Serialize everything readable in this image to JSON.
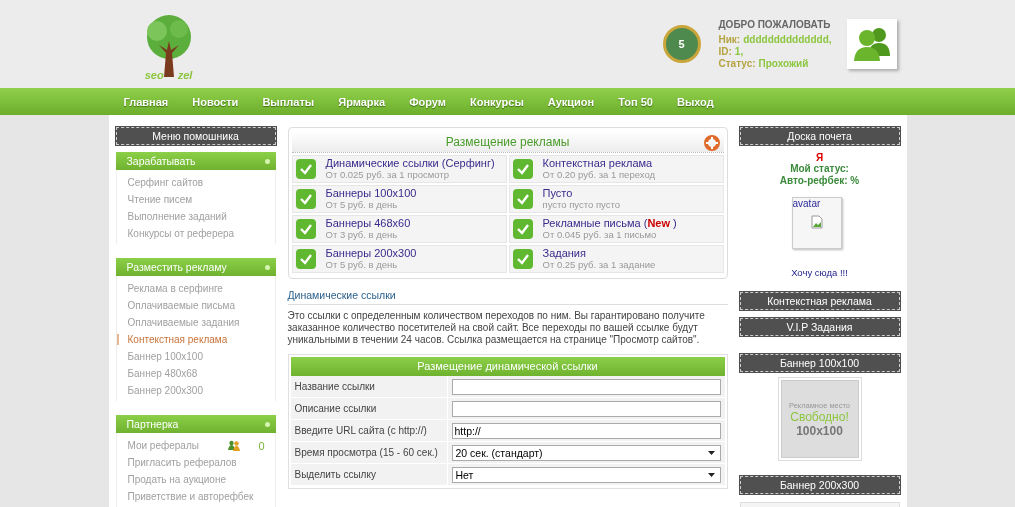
{
  "header": {
    "logo_words": [
      "seo",
      "zel"
    ],
    "rank": "5",
    "welcome": {
      "title": "ДОБРО ПОЖАЛОВАТЬ",
      "lines": [
        {
          "label": "Ник:",
          "value": "dddddddddddddd,"
        },
        {
          "label": "ID:",
          "value": "1,"
        },
        {
          "label": "Статус:",
          "value": "Прохожий"
        }
      ]
    }
  },
  "nav": [
    "Главная",
    "Новости",
    "Выплаты",
    "Ярмарка",
    "Форум",
    "Конкурсы",
    "Аукцион",
    "Топ 50",
    "Выход"
  ],
  "sidebar": {
    "title": "Меню помошника",
    "sections": [
      {
        "title": "Зарабатывать",
        "items": [
          {
            "label": "Серфинг сайтов",
            "selected": false
          },
          {
            "label": "Чтение писем",
            "selected": false
          },
          {
            "label": "Выполнение заданий",
            "selected": false
          },
          {
            "label": "Конкурсы от реферера",
            "selected": false
          }
        ]
      },
      {
        "title": "Разместить рекламу",
        "items": [
          {
            "label": "Реклама в серфинге",
            "selected": false
          },
          {
            "label": "Оплачиваемые письма",
            "selected": false
          },
          {
            "label": "Оплачиваемые задания",
            "selected": false
          },
          {
            "label": "Контекстная реклама",
            "selected": true
          },
          {
            "label": "Баннер 100x100",
            "selected": false
          },
          {
            "label": "Баннер 480x68",
            "selected": false
          },
          {
            "label": "Баннер 200x300",
            "selected": false
          }
        ]
      },
      {
        "title": "Партнерка",
        "items": [
          {
            "label": "Мои рефералы",
            "selected": false,
            "count": "0"
          },
          {
            "label": "Пригласить рефералов",
            "selected": false
          },
          {
            "label": "Продать на аукционе",
            "selected": false
          },
          {
            "label": "Приветствие и авторефбек",
            "selected": false
          }
        ]
      }
    ]
  },
  "ad_panel": {
    "title": "Размещение рекламы",
    "items": [
      {
        "title": "Динамические ссылки (Серфинг)",
        "price": "От 0.025 руб. за 1 просмотр"
      },
      {
        "title": "Контекстная реклама",
        "price": "От 0.20 руб. за 1 переход"
      },
      {
        "title": "Баннеры 100x100",
        "price": "От 5 руб. в день"
      },
      {
        "title": "Пусто",
        "price": "пусто пусто пусто"
      },
      {
        "title": "Баннеры 468x60",
        "price": "От 3 руб. в день"
      },
      {
        "title": "Рекламные письма (**New** )",
        "price": "От 0.045 руб. за 1 письмо"
      },
      {
        "title": "Баннеры 200x300",
        "price": "От 5 руб. в день"
      },
      {
        "title": "Задания",
        "price": "От 0.25 руб. за 1 задание"
      }
    ]
  },
  "section": {
    "title": "Динамические ссылки",
    "description": "Это ссылки с определенным количеством переходов по ним. Вы гарантировано получите заказанное количество посетителей на свой сайт. Все переходы по вашей ссылке будут уникальными в течении 24 часов. Ссылка размещается на странице \"Просмотр сайтов\"."
  },
  "form": {
    "title": "Размещение динамической ссылки",
    "fields": [
      {
        "label": "Название ссылки",
        "kind": "text"
      },
      {
        "label": "Описание ссылки",
        "kind": "text"
      },
      {
        "label": "Введите URL сайта (с http://)",
        "kind": "text",
        "value": "http://"
      },
      {
        "label": "Время просмотра (15 - 60 сек.)",
        "kind": "select",
        "value": "20 сек. (стандарт)"
      },
      {
        "label": "Выделить ссылку",
        "kind": "select",
        "value": "Нет"
      }
    ]
  },
  "right": {
    "honor": {
      "title": "Доска почета",
      "name": "Я",
      "status": "Мой статус:",
      "refback": "Авто-рефбек: %",
      "avatar_alt": "avatar",
      "link": "Хочу сюда !!!"
    },
    "blocks": [
      "Контекстная реклама",
      "V.I.P Задания"
    ],
    "banner_small": {
      "title": "Баннер 100x100",
      "caption": "Рекламное место",
      "free": "Свободно!",
      "size": "100x100"
    },
    "banner_large": {
      "title": "Баннер 200x300"
    }
  }
}
